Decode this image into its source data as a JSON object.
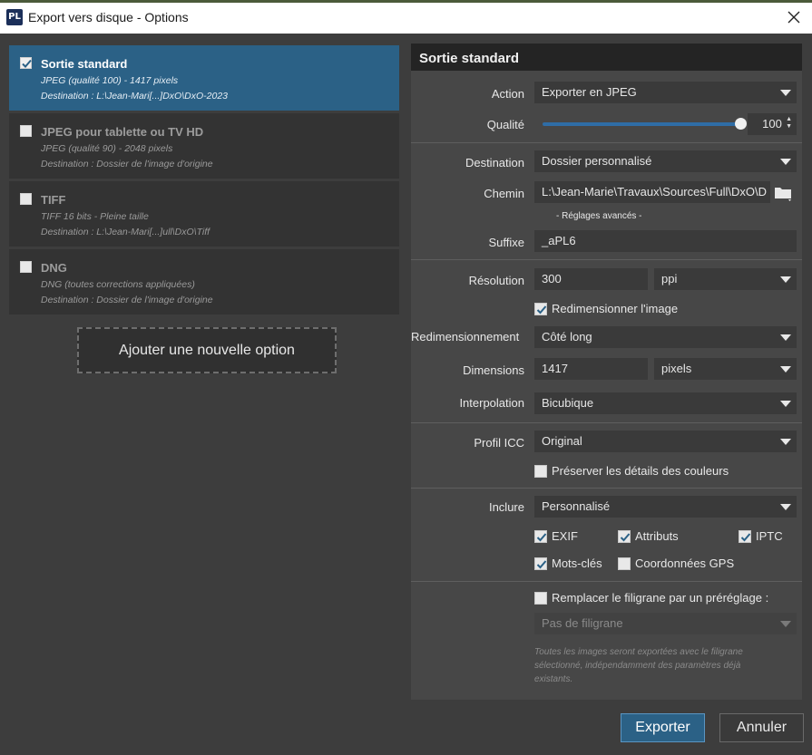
{
  "window": {
    "title": "Export vers disque - Options",
    "app_logo": "PL"
  },
  "presets": [
    {
      "name": "Sortie standard",
      "line1": "JPEG (qualité 100) - 1417 pixels",
      "line2": "Destination : L:\\Jean-Mari[...]DxO\\DxO-2023",
      "checked": true,
      "selected": true
    },
    {
      "name": "JPEG pour tablette ou TV HD",
      "line1": "JPEG (qualité 90) - 2048 pixels",
      "line2": "Destination : Dossier de l'image d'origine",
      "checked": false,
      "selected": false
    },
    {
      "name": "TIFF",
      "line1": "TIFF 16 bits - Pleine taille",
      "line2": "Destination : L:\\Jean-Mari[...]ull\\DxO\\Tiff",
      "checked": false,
      "selected": false
    },
    {
      "name": "DNG",
      "line1": "DNG (toutes corrections appliquées)",
      "line2": "Destination : Dossier de l'image d'origine",
      "checked": false,
      "selected": false
    }
  ],
  "add_option_label": "Ajouter une nouvelle option",
  "panel": {
    "title": "Sortie standard",
    "action": {
      "label": "Action",
      "value": "Exporter en JPEG"
    },
    "quality": {
      "label": "Qualité",
      "value": "100",
      "level": 1.0
    },
    "destination": {
      "label": "Destination",
      "value": "Dossier personnalisé"
    },
    "path": {
      "label": "Chemin",
      "value": "L:\\Jean-Marie\\Travaux\\Sources\\Full\\DxO\\D"
    },
    "advanced_label": "- Réglages avancés -",
    "suffix": {
      "label": "Suffixe",
      "value": "_aPL6"
    },
    "resolution": {
      "label": "Résolution",
      "value": "300",
      "unit": "ppi"
    },
    "resize_checkbox": {
      "label": "Redimensionner l'image",
      "checked": true
    },
    "resize_mode": {
      "label": "Redimensionnement",
      "value": "Côté long"
    },
    "dimensions": {
      "label": "Dimensions",
      "value": "1417",
      "unit": "pixels"
    },
    "interpolation": {
      "label": "Interpolation",
      "value": "Bicubique"
    },
    "icc": {
      "label": "Profil ICC",
      "value": "Original"
    },
    "preserve_colors": {
      "label": "Préserver les détails des couleurs",
      "checked": false
    },
    "include": {
      "label": "Inclure",
      "value": "Personnalisé"
    },
    "include_options": [
      {
        "label": "EXIF",
        "checked": true
      },
      {
        "label": "Attributs",
        "checked": true
      },
      {
        "label": "IPTC",
        "checked": true
      },
      {
        "label": "Mots-clés",
        "checked": true
      },
      {
        "label": "Coordonnées GPS",
        "checked": false
      }
    ],
    "watermark_checkbox": {
      "label": "Remplacer le filigrane par un préréglage :",
      "checked": false
    },
    "watermark_select": {
      "value": "Pas de filigrane"
    },
    "watermark_note": "Toutes les images seront exportées avec le filigrane sélectionné, indépendamment des paramètres déjà existants."
  },
  "buttons": {
    "export": "Exporter",
    "cancel": "Annuler"
  },
  "colors": {
    "accent": "#2b6186",
    "slider": "#2f6da6"
  }
}
